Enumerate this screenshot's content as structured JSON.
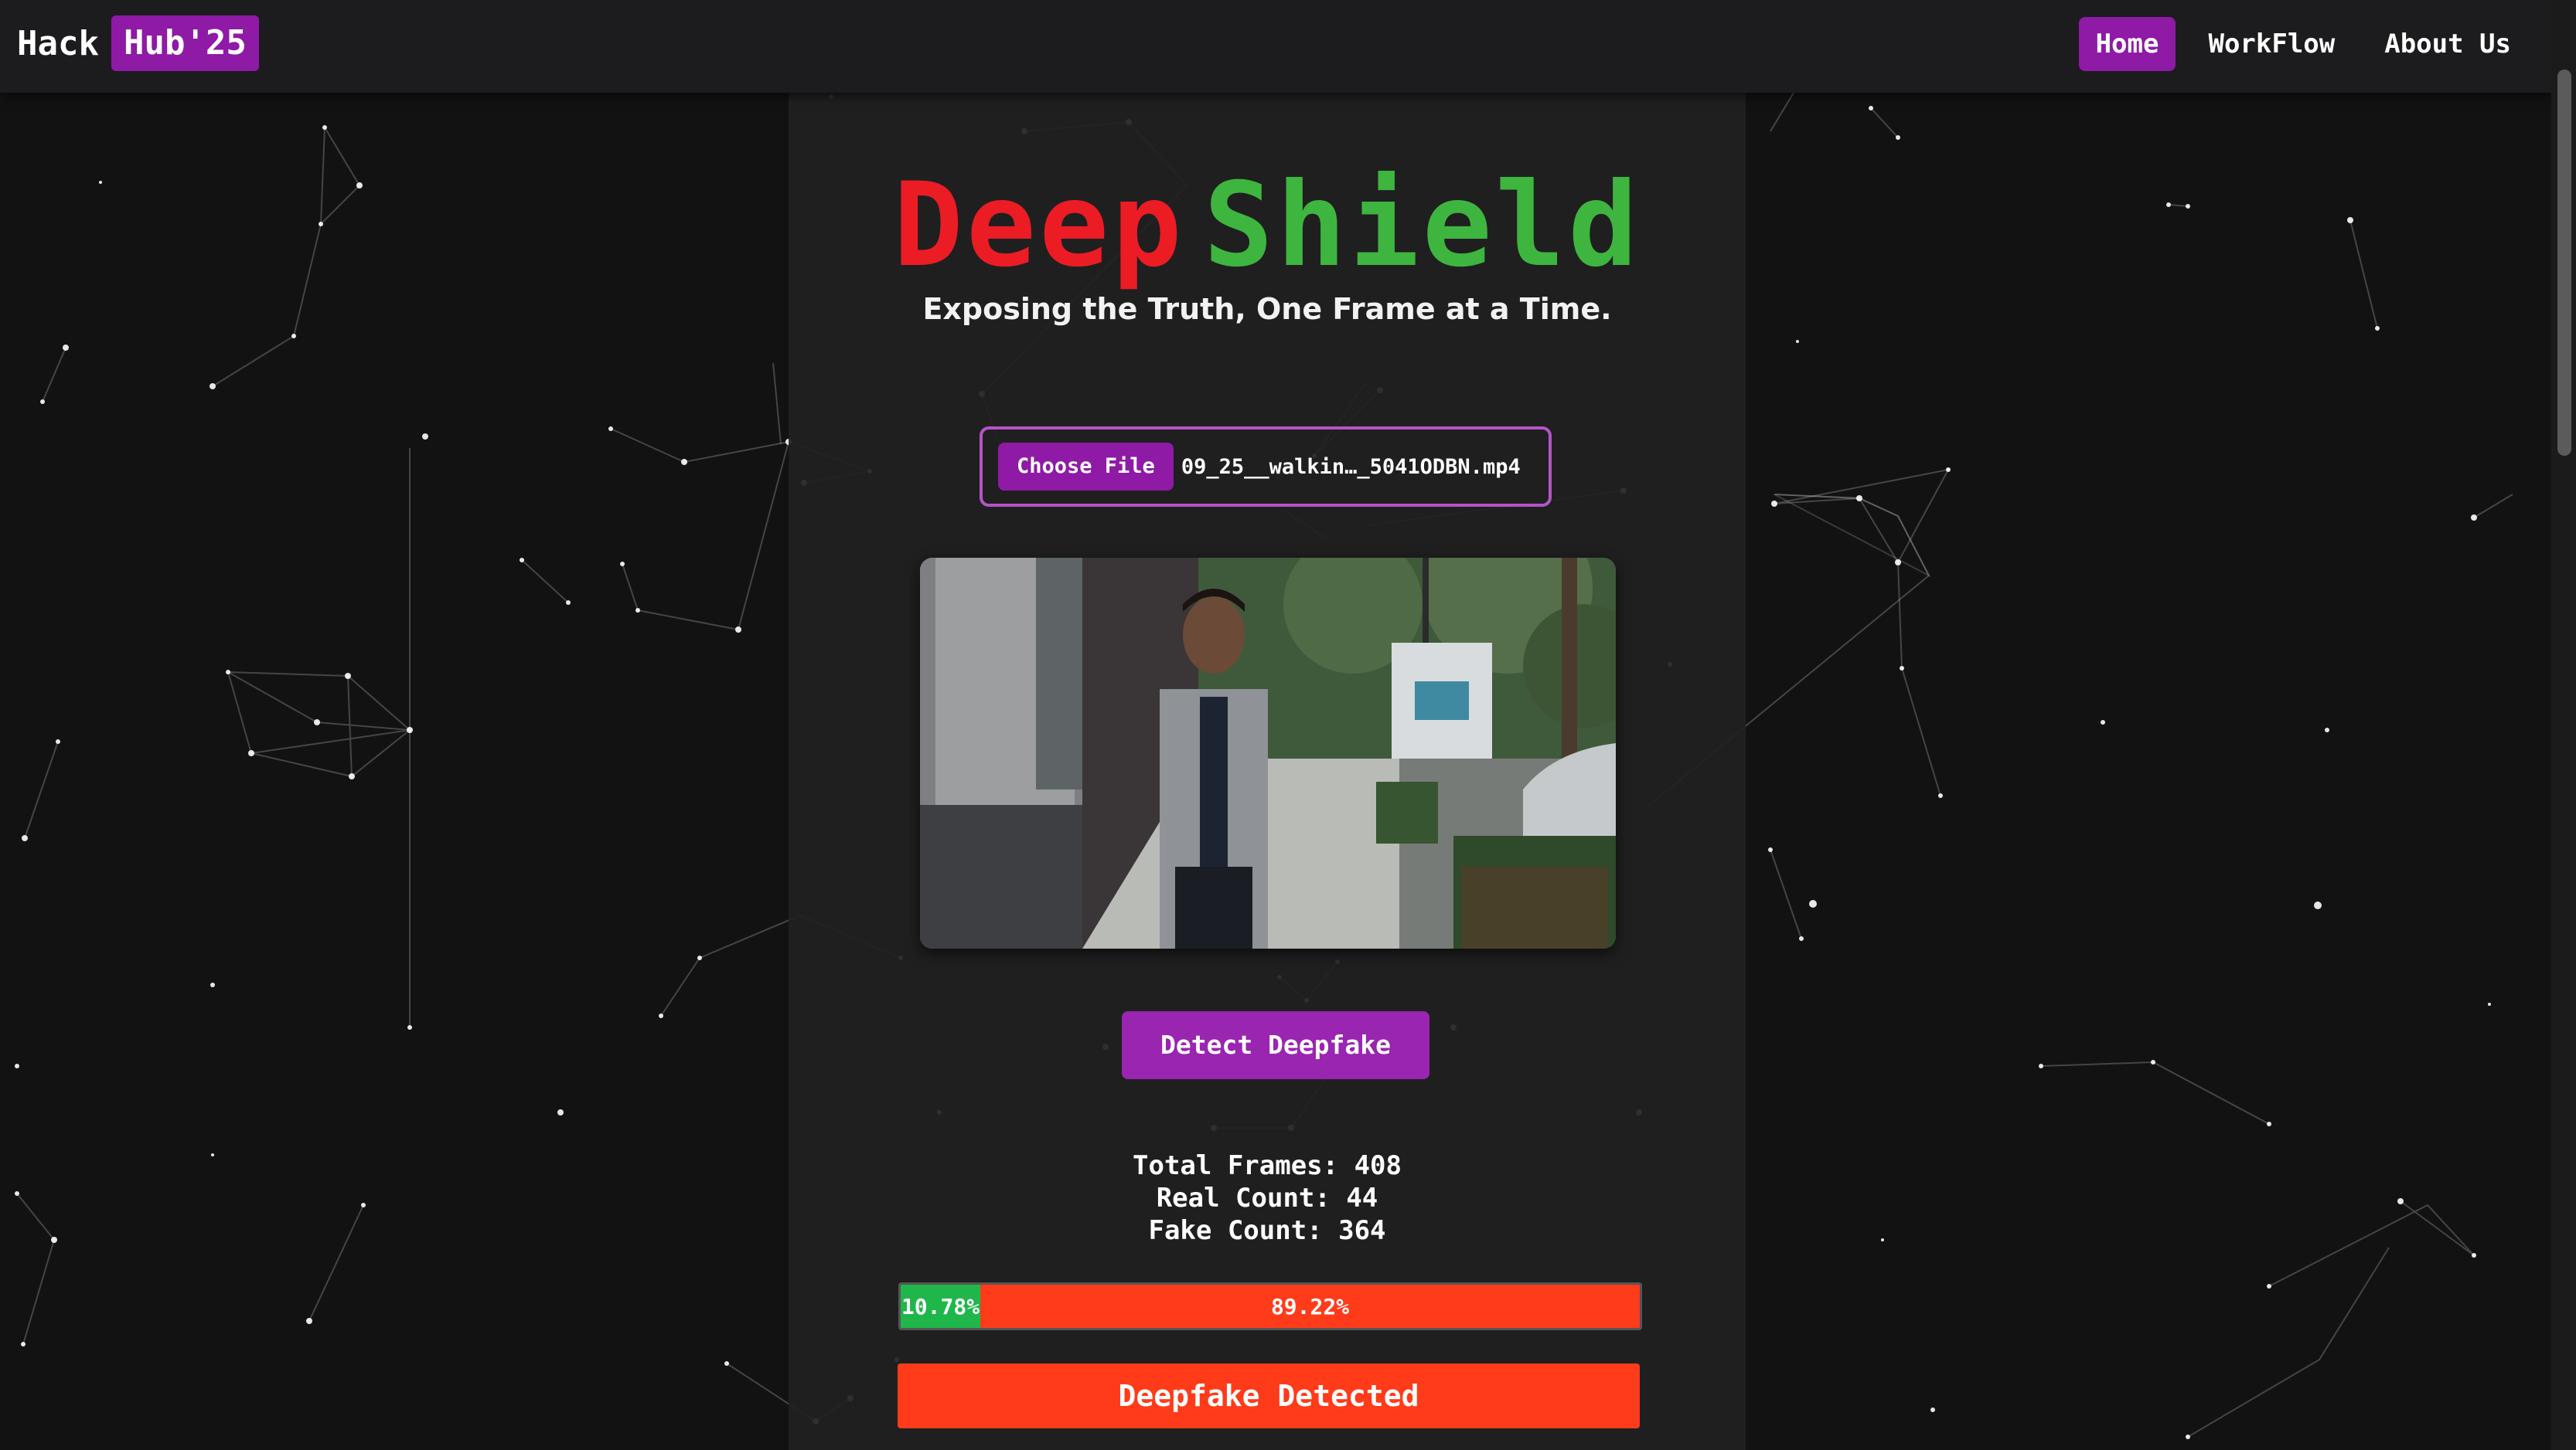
{
  "navbar": {
    "brand_text": "Hack",
    "brand_badge": "Hub'25",
    "links": [
      {
        "label": "Home",
        "active": true
      },
      {
        "label": "WorkFlow",
        "active": false
      },
      {
        "label": "About Us",
        "active": false
      }
    ]
  },
  "hero": {
    "title_part1": "Deep",
    "title_part2": "Shield",
    "tagline": "Exposing the Truth, One Frame at a Time."
  },
  "upload": {
    "choose_label": "Choose File",
    "file_name": "09_25__walkin…_5041ODBN.mp4"
  },
  "detect_button": "Detect Deepfake",
  "stats": {
    "total_label": "Total Frames: 408",
    "real_label": "Real Count: 44",
    "fake_label": "Fake Count: 364"
  },
  "progress": {
    "real_percent_label": "10.78%",
    "fake_percent_label": "89.22%",
    "real_fraction": 0.1078,
    "fake_fraction": 0.8922
  },
  "result_banner": "Deepfake Detected",
  "colors": {
    "accent": "#8e1aa6",
    "title_deep": "#ec1c24",
    "title_shield": "#3eb53f",
    "real": "#1fb74a",
    "fake": "#ff3b1a"
  }
}
